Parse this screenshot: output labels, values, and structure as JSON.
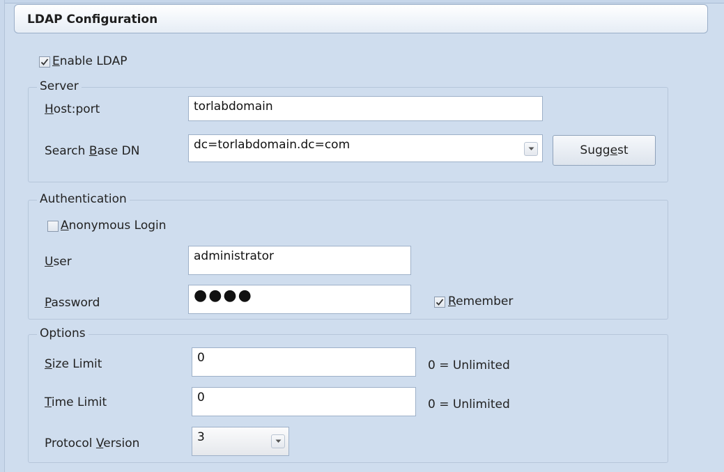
{
  "header": {
    "title": "LDAP Configuration"
  },
  "enable_ldap": {
    "label_u": "E",
    "label_rest": "nable LDAP",
    "checked": true
  },
  "server": {
    "legend": "Server",
    "host": {
      "label_u": "H",
      "label_rest": "ost:port",
      "value": "torlabdomain"
    },
    "search_base": {
      "label_pre": "Search ",
      "label_u": "B",
      "label_rest": "ase DN",
      "value": "dc=torlabdomain.dc=com"
    },
    "suggest": {
      "pre": "Sugg",
      "u": "e",
      "post": "st"
    }
  },
  "authentication": {
    "legend": "Authentication",
    "anonymous": {
      "label_u": "A",
      "label_rest": "nonymous Login",
      "checked": false
    },
    "user": {
      "label_u": "U",
      "label_rest": "ser",
      "value": "administrator"
    },
    "password": {
      "label_u": "P",
      "label_rest": "assword",
      "value": "●●●●"
    },
    "remember": {
      "label_u": "R",
      "label_rest": "emember",
      "checked": true
    }
  },
  "options": {
    "legend": "Options",
    "size_limit": {
      "label_u": "S",
      "label_rest": "ize Limit",
      "value": "0",
      "hint": "0 = Unlimited"
    },
    "time_limit": {
      "label_u": "T",
      "label_rest": "ime Limit",
      "value": "0",
      "hint": "0 = Unlimited"
    },
    "protocol": {
      "label_pre": "Protocol ",
      "label_u": "V",
      "label_rest": "ersion",
      "value": "3"
    }
  }
}
